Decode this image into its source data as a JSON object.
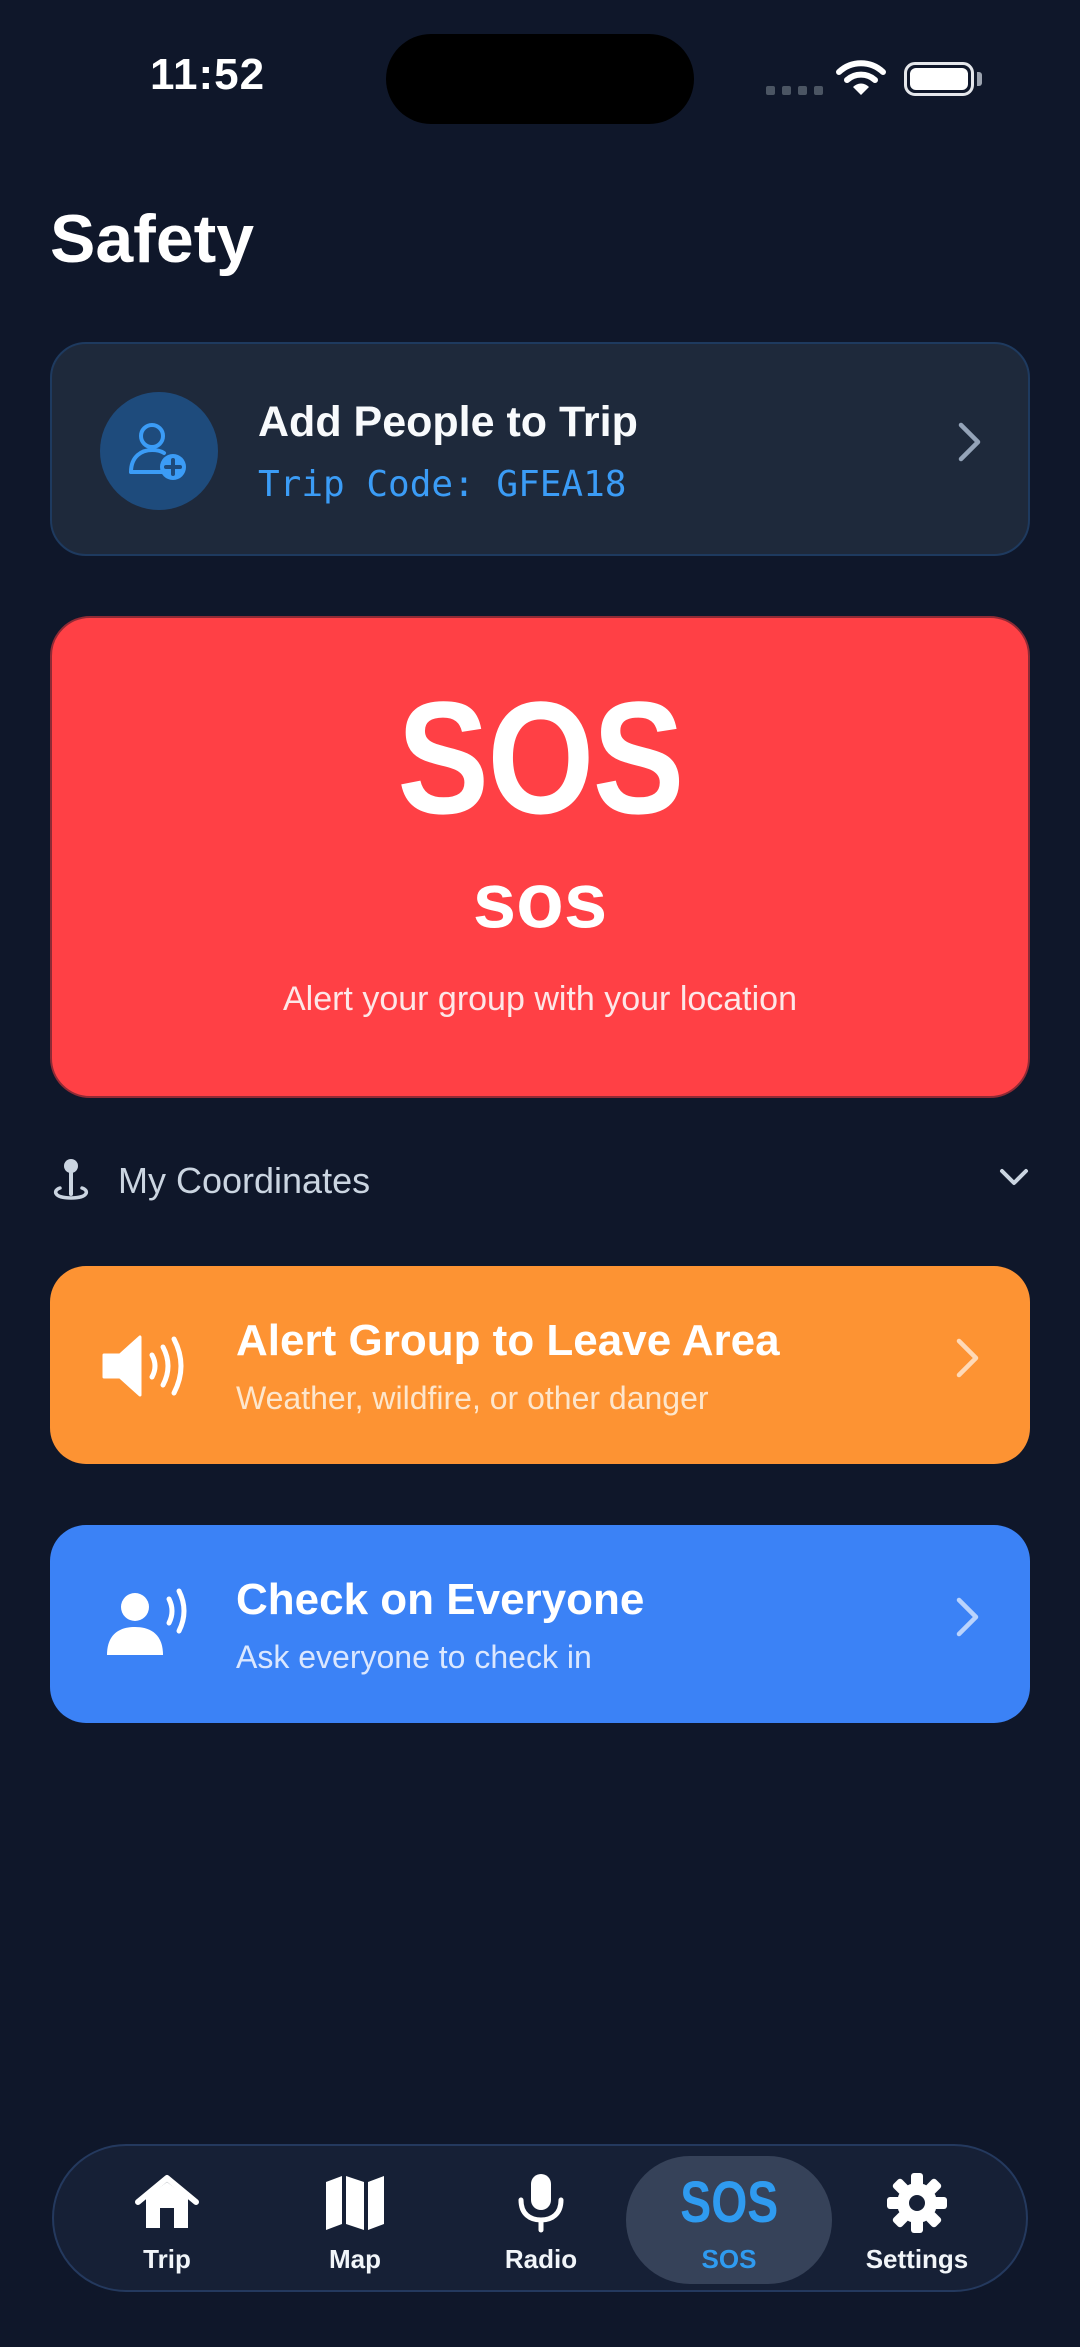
{
  "status_bar": {
    "time": "11:52"
  },
  "page": {
    "title": "Safety"
  },
  "people_card": {
    "title": "Add People to Trip",
    "code": "Trip Code: GFEA18"
  },
  "sos_card": {
    "big": "SOS",
    "small": "sos",
    "subtitle": "Alert your group with your location"
  },
  "coordinates": {
    "label": "My Coordinates"
  },
  "actions": [
    {
      "title": "Alert Group to Leave Area",
      "subtitle": "Weather, wildfire, or other danger",
      "color": "#fd9333"
    },
    {
      "title": "Check on Everyone",
      "subtitle": "Ask everyone to check in",
      "color": "#3b82f6"
    }
  ],
  "tabs": [
    {
      "label": "Trip",
      "icon": "home-icon"
    },
    {
      "label": "Map",
      "icon": "map-icon"
    },
    {
      "label": "Radio",
      "icon": "microphone-icon"
    },
    {
      "label": "SOS",
      "icon": "sos-text-icon",
      "glyph": "SOS",
      "active": true
    },
    {
      "label": "Settings",
      "icon": "gear-icon"
    }
  ],
  "colors": {
    "background": "#0f172a",
    "accent": "#2f9bf0",
    "sos": "#ff4045"
  }
}
